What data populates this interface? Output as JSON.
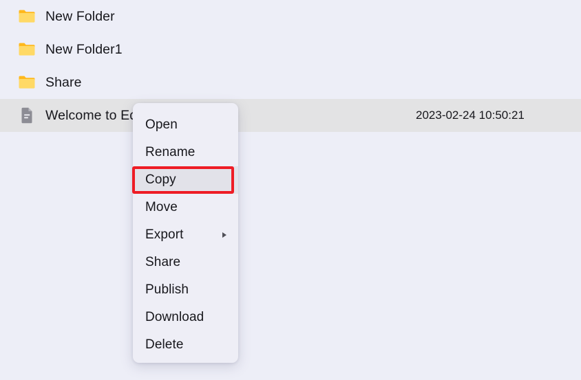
{
  "colors": {
    "page_background": "#edeef7",
    "selected_row_background": "#e3e3e4",
    "menu_background": "#eeeef6",
    "menu_hover_background": "#e2e2e9",
    "text": "#17171c",
    "folder_icon_front": "#ffd966",
    "folder_icon_back": "#ffb81c",
    "file_icon": "#8c8c94",
    "annotation_red": "#ee1c25"
  },
  "file_list": {
    "rows": [
      {
        "icon": "folder-icon",
        "name": "New Folder",
        "date": "",
        "selected": false
      },
      {
        "icon": "folder-icon",
        "name": "New Folder1",
        "date": "",
        "selected": false
      },
      {
        "icon": "folder-icon",
        "name": "Share",
        "date": "",
        "selected": false
      },
      {
        "icon": "file-icon",
        "name": "Welcome to Edit",
        "date": "2023-02-24 10:50:21",
        "selected": true
      }
    ]
  },
  "context_menu": {
    "items": [
      {
        "label": "Open",
        "has_submenu": false,
        "hovered": false
      },
      {
        "label": "Rename",
        "has_submenu": false,
        "hovered": false
      },
      {
        "label": "Copy",
        "has_submenu": false,
        "hovered": true
      },
      {
        "label": "Move",
        "has_submenu": false,
        "hovered": false
      },
      {
        "label": "Export",
        "has_submenu": true,
        "hovered": false
      },
      {
        "label": "Share",
        "has_submenu": false,
        "hovered": false
      },
      {
        "label": "Publish",
        "has_submenu": false,
        "hovered": false
      },
      {
        "label": "Download",
        "has_submenu": false,
        "hovered": false
      },
      {
        "label": "Delete",
        "has_submenu": false,
        "hovered": false
      }
    ]
  },
  "annotation": {
    "target_label": "Copy",
    "shape": "rectangle",
    "color": "#ee1c25"
  }
}
